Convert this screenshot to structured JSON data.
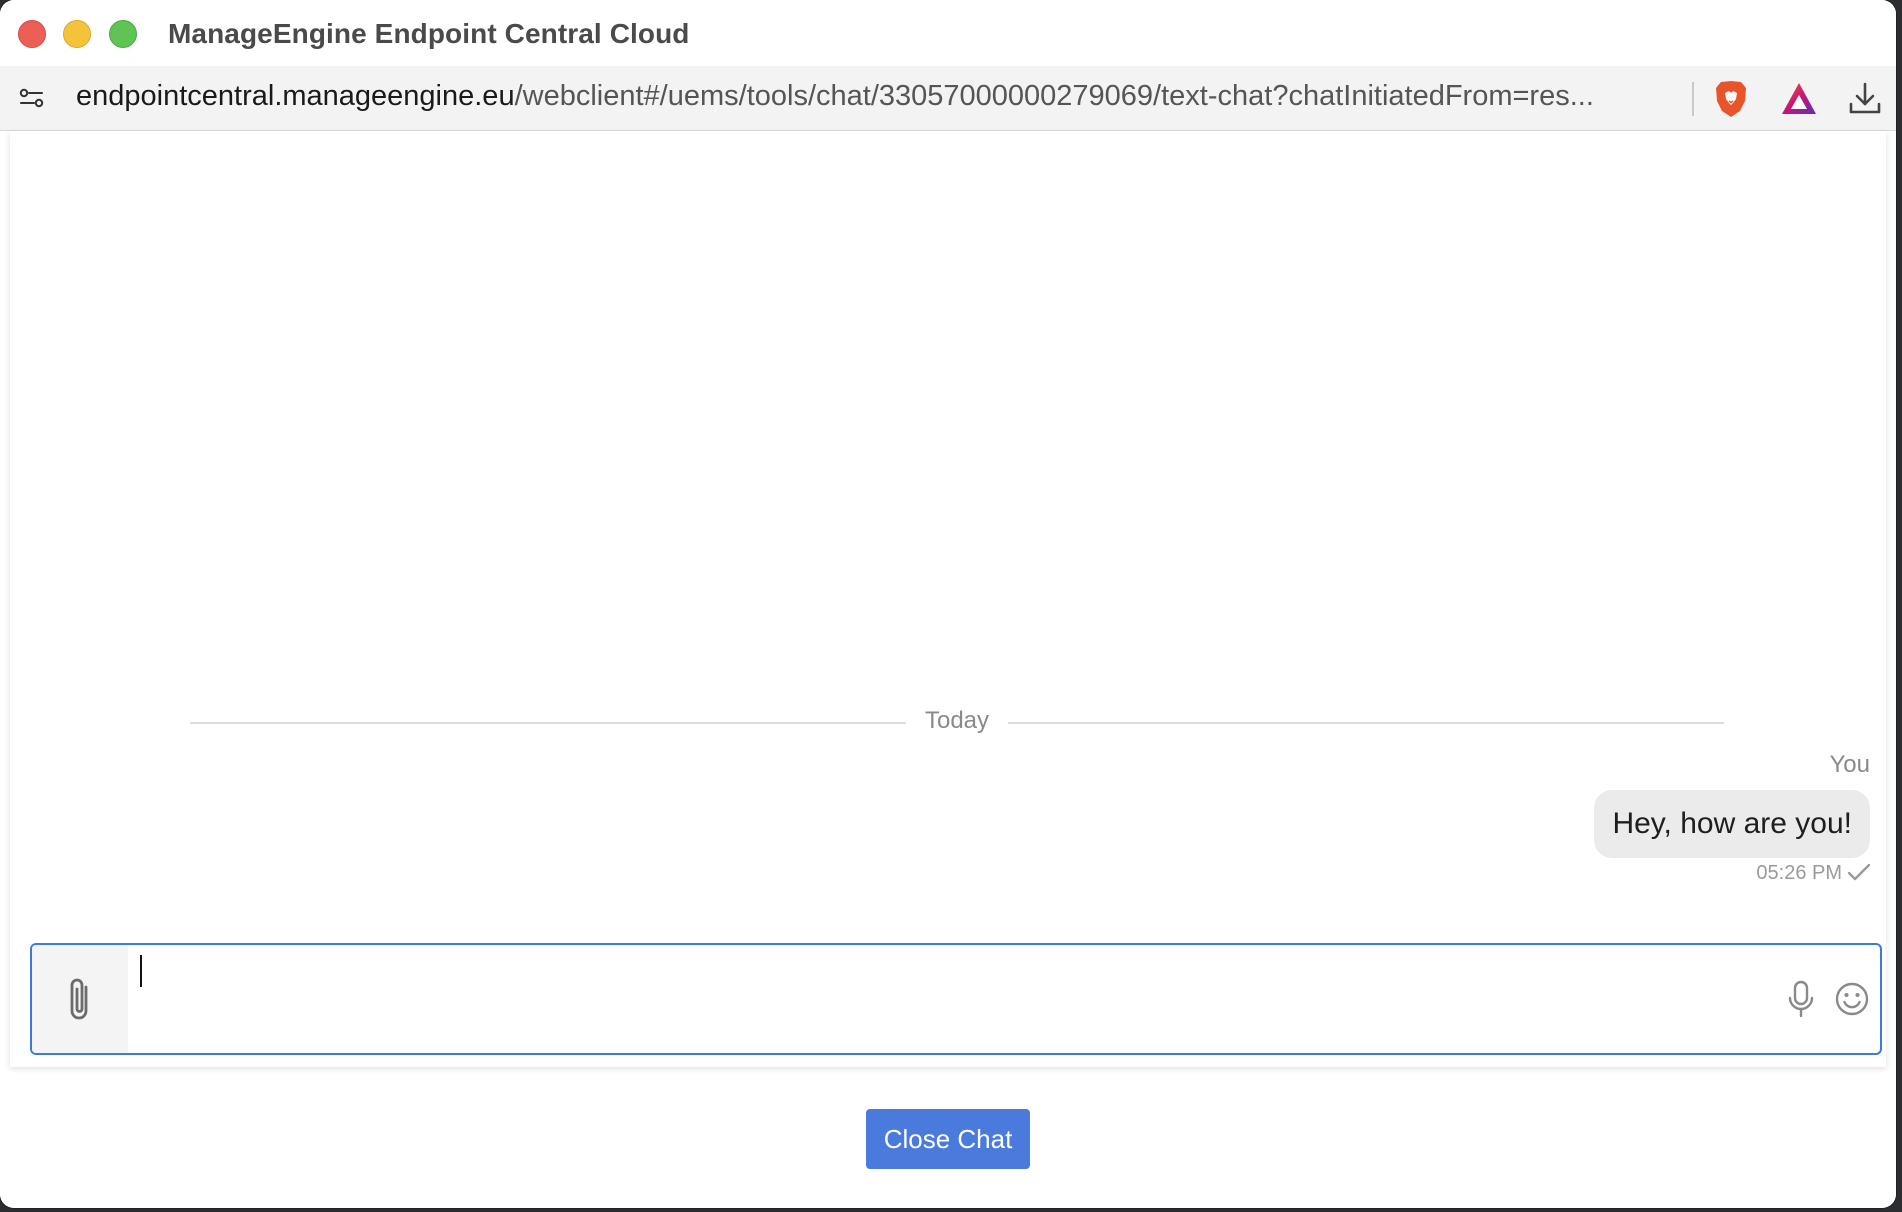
{
  "window": {
    "title": "ManageEngine Endpoint Central Cloud"
  },
  "address_bar": {
    "host": "endpointcentral.manageengine.eu",
    "path": "/webclient#/uems/tools/chat/33057000000279069/text-chat?chatInitiatedFrom=res..."
  },
  "toolbar_icons": [
    "site-settings-icon",
    "brave-shields-icon",
    "brave-rewards-icon",
    "download-icon"
  ],
  "chat": {
    "date_divider": "Today",
    "messages": [
      {
        "sender": "You",
        "text": "Hey, how are you!",
        "time": "05:26 PM",
        "status_icon": "check-icon"
      }
    ],
    "composer": {
      "value": "",
      "placeholder": ""
    },
    "composer_icons": [
      "paperclip-icon",
      "microphone-icon",
      "emoji-icon"
    ]
  },
  "footer": {
    "close_label": "Close Chat"
  },
  "colors": {
    "accent": "#4a7bdc",
    "composer_border": "#3d7bd9",
    "bubble_bg": "#ebebeb",
    "close_traffic": "#ec5f57",
    "minimize_traffic": "#f5c33b",
    "zoom_traffic": "#5fc454"
  }
}
